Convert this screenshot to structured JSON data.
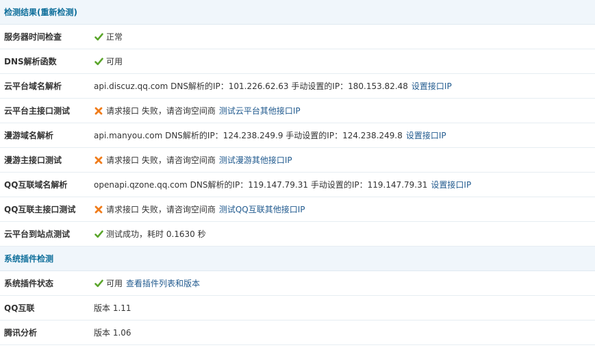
{
  "sections": {
    "detect_title": "检测结果",
    "redetect_open": "(",
    "redetect_link": "重新检测",
    "redetect_close": ")",
    "plugin_title": "系统插件检测"
  },
  "rows": {
    "server_time": {
      "label": "服务器时间检查",
      "status": "正常"
    },
    "dns_func": {
      "label": "DNS解析函数",
      "status": "可用"
    },
    "cloud_domain": {
      "label": "云平台域名解析",
      "text": "api.discuz.qq.com DNS解析的IP：101.226.62.63 手动设置的IP：180.153.82.48",
      "link": "设置接口IP"
    },
    "cloud_main": {
      "label": "云平台主接口测试",
      "status": "请求接口 失败，请咨询空间商",
      "link": "测试云平台其他接口IP"
    },
    "manyou_domain": {
      "label": "漫游域名解析",
      "text": "api.manyou.com DNS解析的IP：124.238.249.9 手动设置的IP：124.238.249.8",
      "link": "设置接口IP"
    },
    "manyou_main": {
      "label": "漫游主接口测试",
      "status": "请求接口 失败，请咨询空间商",
      "link": "测试漫游其他接口IP"
    },
    "qq_domain": {
      "label": "QQ互联域名解析",
      "text": "openapi.qzone.qq.com DNS解析的IP：119.147.79.31 手动设置的IP：119.147.79.31",
      "link": "设置接口IP"
    },
    "qq_main": {
      "label": "QQ互联主接口测试",
      "status": "请求接口 失败，请咨询空间商",
      "link": "测试QQ互联其他接口IP"
    },
    "cloud_site": {
      "label": "云平台到站点测试",
      "status": "测试成功，耗时 0.1630 秒"
    },
    "plugin_status": {
      "label": "系统插件状态",
      "status": "可用",
      "link": "查看插件列表和版本"
    },
    "qq_connect": {
      "label": "QQ互联",
      "text": "版本 1.11"
    },
    "tencent_analytics": {
      "label": "腾讯分析",
      "text": "版本 1.06"
    }
  },
  "colors": {
    "header_bg": "#f0f6fb",
    "header_text": "#0f6f9b",
    "link": "#225b8f",
    "ok_icon": "#5aa52a",
    "fail_icon": "#f07c1a"
  }
}
